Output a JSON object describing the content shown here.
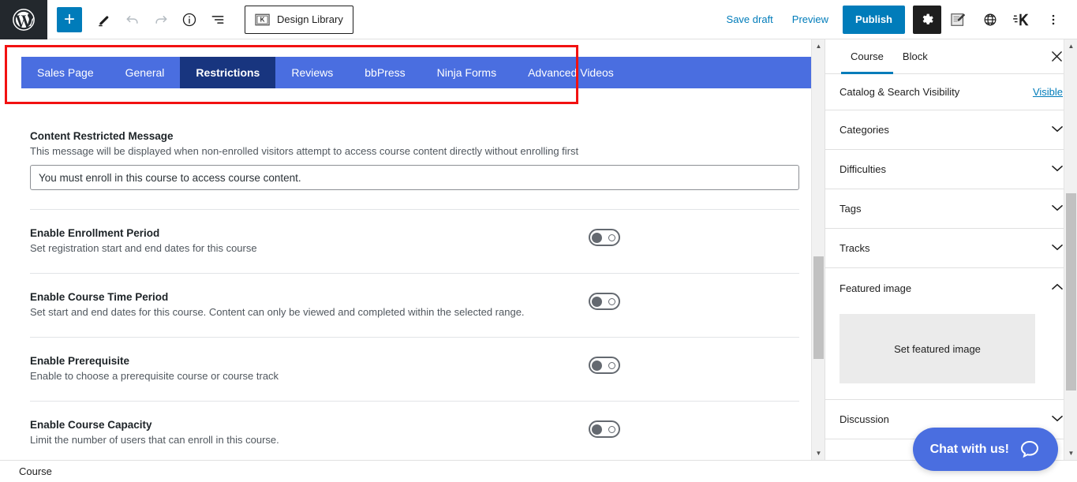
{
  "toolbar": {
    "logo": "wordpress-logo",
    "add_block_label": "+",
    "edit_tool": "pencil-icon",
    "undo": "undo-icon",
    "redo": "redo-icon",
    "details": "info-icon",
    "list_view": "list-view-icon",
    "design_library_label": "Design Library",
    "save_draft_label": "Save draft",
    "preview_label": "Preview",
    "publish_label": "Publish",
    "settings": "gear-icon",
    "edit_doc": "edit-document-icon",
    "globe": "globe-icon",
    "kadence": "kadence-icon",
    "more_options": "vertical-dots-icon"
  },
  "course_tabs": {
    "items": [
      {
        "label": "Sales Page",
        "active": false
      },
      {
        "label": "General",
        "active": false
      },
      {
        "label": "Restrictions",
        "active": true
      },
      {
        "label": "Reviews",
        "active": false
      },
      {
        "label": "bbPress",
        "active": false
      },
      {
        "label": "Ninja Forms",
        "active": false
      },
      {
        "label": "Advanced Videos",
        "active": false
      }
    ],
    "bar_color": "#4a6ee0",
    "active_color": "#18357f",
    "highlight_color": "#f21111"
  },
  "restrictions": {
    "message_field": {
      "label": "Content Restricted Message",
      "description": "This message will be displayed when non-enrolled visitors attempt to access course content directly without enrolling first",
      "value": "You must enroll in this course to access course content.",
      "placeholder": "You must enroll in this course to access course content."
    },
    "toggles": [
      {
        "title": "Enable Enrollment Period",
        "description": "Set registration start and end dates for this course",
        "state": "off"
      },
      {
        "title": "Enable Course Time Period",
        "description": "Set start and end dates for this course. Content can only be viewed and completed within the selected range.",
        "state": "off"
      },
      {
        "title": "Enable Prerequisite",
        "description": "Enable to choose a prerequisite course or course track",
        "state": "off"
      },
      {
        "title": "Enable Course Capacity",
        "description": "Limit the number of users that can enroll in this course.",
        "state": "off"
      }
    ]
  },
  "sidebar": {
    "tabs": [
      {
        "label": "Course",
        "active": true
      },
      {
        "label": "Block",
        "active": false
      }
    ],
    "close_icon": "close-icon",
    "visibility_row": {
      "label": "Catalog & Search Visibility",
      "value": "Visible"
    },
    "panels": [
      {
        "label": "Categories",
        "expanded": false
      },
      {
        "label": "Difficulties",
        "expanded": false
      },
      {
        "label": "Tags",
        "expanded": false
      },
      {
        "label": "Tracks",
        "expanded": false
      }
    ],
    "featured_image": {
      "label": "Featured image",
      "expanded": true,
      "placeholder_label": "Set featured image"
    },
    "discussion": {
      "label": "Discussion",
      "expanded": false
    }
  },
  "bottom_bar": {
    "breadcrumb": "Course"
  },
  "chat_widget": {
    "label": "Chat with us!",
    "icon": "chat-bubble-icon",
    "color": "#4a6ee0"
  }
}
